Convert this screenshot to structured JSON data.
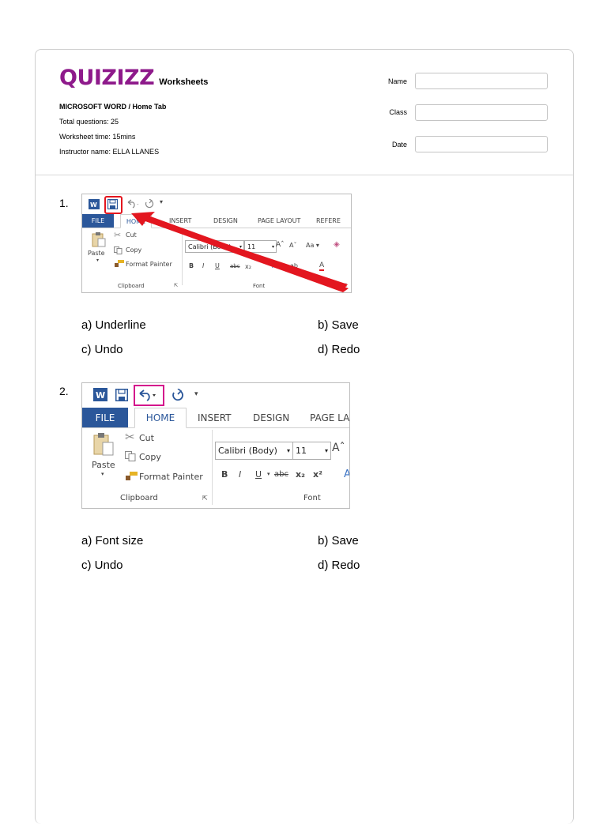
{
  "header": {
    "logo_text": "QUIZIZZ",
    "logo_sub": "Worksheets",
    "title": "MICROSOFT WORD / Home Tab",
    "total_questions": "Total questions: 25",
    "worksheet_time": "Worksheet time: 15mins",
    "instructor": "Instructor name: ELLA LLANES",
    "fields": [
      {
        "label": "Name",
        "value": ""
      },
      {
        "label": "Class",
        "value": ""
      },
      {
        "label": "Date",
        "value": ""
      }
    ],
    "brand_color": "#8e1a8b"
  },
  "questions": [
    {
      "number": "1.",
      "options": [
        "a) Underline",
        "b) Save",
        "c) Undo",
        "d) Redo"
      ],
      "image": {
        "tabs": [
          "FILE",
          "HOME",
          "INSERT",
          "DESIGN",
          "PAGE LAYOUT",
          "REFERE"
        ],
        "cut": "Cut",
        "copy": "Copy",
        "paste": "Paste",
        "format_painter": "Format Painter",
        "font_name": "Calibri (Body)",
        "font_size": "11",
        "group_clipboard": "Clipboard",
        "group_font": "Font",
        "highlight": "save-icon",
        "highlight_color": "#e3161f"
      }
    },
    {
      "number": "2.",
      "options": [
        "a) Font size",
        "b) Save",
        "c) Undo",
        "d) Redo"
      ],
      "image": {
        "tabs": [
          "FILE",
          "HOME",
          "INSERT",
          "DESIGN",
          "PAGE LA"
        ],
        "cut": "Cut",
        "copy": "Copy",
        "paste": "Paste",
        "format_painter": "Format Painter",
        "font_name": "Calibri (Body)",
        "font_size": "11",
        "group_clipboard": "Clipboard",
        "group_font": "Font",
        "highlight": "undo-icon",
        "highlight_color": "#d4148c"
      }
    }
  ]
}
